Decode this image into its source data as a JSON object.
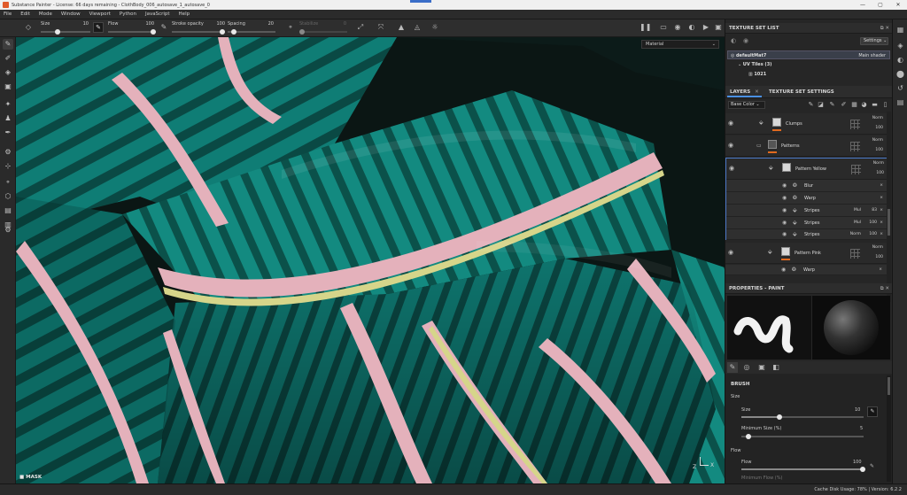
{
  "window": {
    "title": "Substance Painter - License: 66 days remaining - ClothBody_006_autosave_1_autosave_0",
    "controls": [
      "—",
      "▢",
      "✕"
    ]
  },
  "menu": [
    "File",
    "Edit",
    "Mode",
    "Window",
    "Viewport",
    "Python",
    "JavaScript",
    "Help"
  ],
  "tool_properties": {
    "size_label": "Size",
    "size_value": "10",
    "flow_label": "Flow",
    "flow_value": "100",
    "stroke_opacity_label": "Stroke opacity",
    "stroke_opacity_value": "100",
    "spacing_label": "Spacing",
    "spacing_value": "20",
    "stabilize_label": "Stabilize",
    "stabilize_value": "0"
  },
  "viewport": {
    "material_select": "Material",
    "mask_label": "MASK",
    "axis_x": "X",
    "axis_z": "Z",
    "cloth_colors": {
      "base": "#0e7a72",
      "dark_stripe": "#0b4a44",
      "pink": "#e7b3bd",
      "yellow": "#d8d78a"
    }
  },
  "texture_set_list": {
    "header": "TEXTURE SET LIST",
    "settings_button": "Settings",
    "set_name": "defaultMat7",
    "shader": "Main shader",
    "uv_tiles": "UV Tiles (3)",
    "tile": "1021"
  },
  "tabs": {
    "layers": "LAYERS",
    "texture_set_settings": "TEXTURE SET SETTINGS"
  },
  "layers": {
    "channel_select": "Base Color",
    "rows": [
      {
        "name": "Clumps",
        "blend": "Norm",
        "opacity": "100"
      },
      {
        "name": "Patterns",
        "blend": "Norm",
        "opacity": "100"
      },
      {
        "name": "Pattern Yellow",
        "blend": "Norm",
        "opacity": "100"
      },
      {
        "name": "Pattern Pink",
        "blend": "Norm",
        "opacity": "100"
      }
    ],
    "effects_yellow": [
      {
        "name": "Blur",
        "blend": "",
        "opacity": ""
      },
      {
        "name": "Warp",
        "blend": "",
        "opacity": ""
      },
      {
        "name": "Stripes",
        "blend": "Mul",
        "opacity": "83"
      },
      {
        "name": "Stripes",
        "blend": "Mul",
        "opacity": "100"
      },
      {
        "name": "Stripes",
        "blend": "Norm",
        "opacity": "100"
      }
    ],
    "effects_pink": [
      {
        "name": "Warp"
      }
    ]
  },
  "properties": {
    "header": "PROPERTIES - PAINT",
    "brush_heading": "BRUSH",
    "size_section": "Size",
    "size_label": "Size",
    "size_value": "10",
    "min_size_label": "Minimum Size (%)",
    "min_size_value": "5",
    "flow_section": "Flow",
    "flow_label": "Flow",
    "flow_value": "100",
    "min_flow_label": "Minimum Flow (%)"
  },
  "status": {
    "text": "Cache Disk Usage:  78% | Version: 6.2.2"
  }
}
